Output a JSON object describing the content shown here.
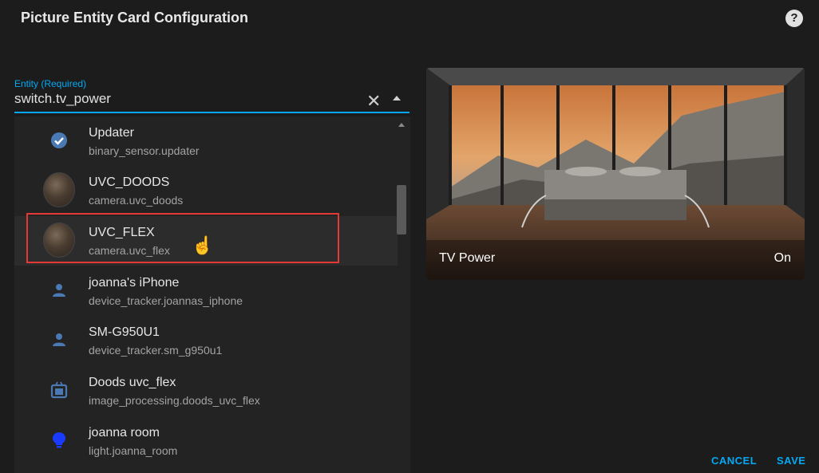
{
  "dialog": {
    "title": "Picture Entity Card Configuration"
  },
  "help_icon": "question-circle-icon",
  "entity_field": {
    "label": "Entity (Required)",
    "value": "switch.tv_power"
  },
  "list": {
    "items": [
      {
        "name": "Updater",
        "id": "binary_sensor.updater",
        "icon": "check-circle-icon"
      },
      {
        "name": "UVC_DOODS",
        "id": "camera.uvc_doods",
        "icon": "camera-avatar"
      },
      {
        "name": "UVC_FLEX",
        "id": "camera.uvc_flex",
        "icon": "camera-avatar"
      },
      {
        "name": "joanna's iPhone",
        "id": "device_tracker.joannas_iphone",
        "icon": "person-icon"
      },
      {
        "name": "SM-G950U1",
        "id": "device_tracker.sm_g950u1",
        "icon": "person-icon"
      },
      {
        "name": "Doods uvc_flex",
        "id": "image_processing.doods_uvc_flex",
        "icon": "image-filter-icon"
      },
      {
        "name": "joanna room",
        "id": "light.joanna_room",
        "icon": "lightbulb-icon"
      }
    ]
  },
  "preview": {
    "name": "TV Power",
    "state": "On"
  },
  "buttons": {
    "cancel": "CANCEL",
    "save": "SAVE"
  },
  "colors": {
    "accent": "#03a9f4",
    "highlight_box": "#e53935",
    "state_icon": "#4a79b4",
    "light_icon": "#1a3aff"
  }
}
